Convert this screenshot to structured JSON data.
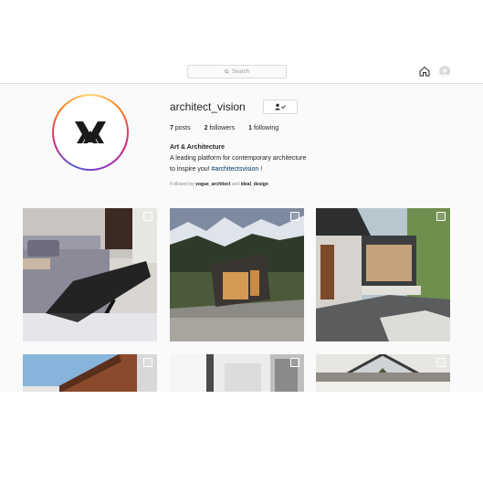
{
  "search": {
    "placeholder": "Search"
  },
  "nav": {
    "home_icon": "home-icon",
    "profile_icon": "avatar-icon"
  },
  "profile": {
    "username": "architect_vision",
    "follow_icon": "person-check-icon",
    "stats": [
      {
        "count": "7",
        "label": "posts"
      },
      {
        "count": "2",
        "label": "followers"
      },
      {
        "count": "1",
        "label": "following"
      }
    ],
    "bio_name": "Art & Architecture",
    "bio_line1": "A leading platform for contemporary architecture",
    "bio_line2_prefix": "to inspire you! ",
    "bio_hashtag": "#architectsvision",
    "bio_line2_suffix": " !",
    "followed_by_prefix": "Followed by ",
    "followed_user1": "vogue_architect",
    "followed_and": " and ",
    "followed_user2": "ideal_design"
  },
  "posts": [
    {
      "subject": "bedroom-interior",
      "multi": true
    },
    {
      "subject": "mountain-cabin",
      "multi": true
    },
    {
      "subject": "modern-house-terrace",
      "multi": true
    },
    {
      "subject": "wood-facade-building",
      "multi": true
    },
    {
      "subject": "white-interior-corridor",
      "multi": true
    },
    {
      "subject": "a-frame-ceiling",
      "multi": true
    }
  ],
  "colors": {
    "accent_link": "#003569",
    "border": "#dbdbdb",
    "background": "#fafafa"
  }
}
